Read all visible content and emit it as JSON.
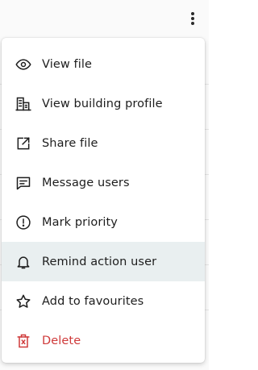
{
  "colors": {
    "text": "#1d1d1d",
    "danger": "#cf3a3a",
    "highlight": "#e9eff0"
  },
  "menu": {
    "items": [
      {
        "label": "View file",
        "icon": "eye-icon"
      },
      {
        "label": "View building profile",
        "icon": "building-icon"
      },
      {
        "label": "Share file",
        "icon": "external-link-icon"
      },
      {
        "label": "Message users",
        "icon": "message-icon"
      },
      {
        "label": "Mark priority",
        "icon": "alert-circle-icon"
      },
      {
        "label": "Remind action user",
        "icon": "bell-icon",
        "highlighted": true
      },
      {
        "label": "Add to favourites",
        "icon": "star-icon"
      },
      {
        "label": "Delete",
        "icon": "trash-icon",
        "danger": true
      }
    ]
  }
}
